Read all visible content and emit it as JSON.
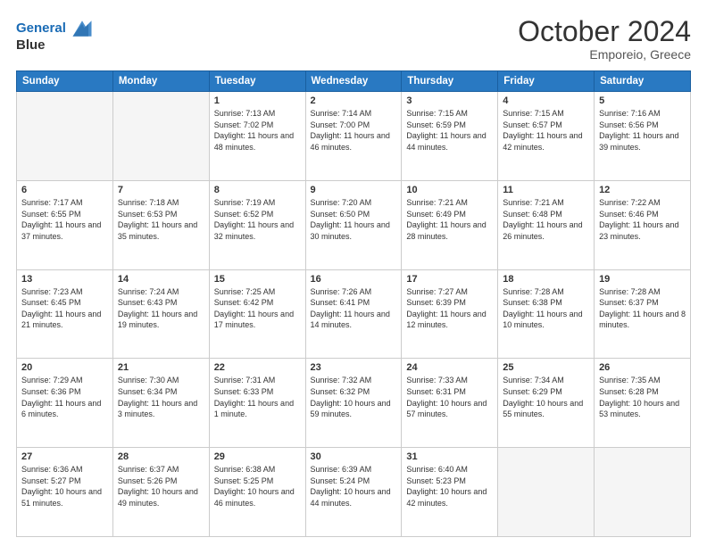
{
  "header": {
    "logo_line1": "General",
    "logo_line2": "Blue",
    "month": "October 2024",
    "location": "Emporeio, Greece"
  },
  "weekdays": [
    "Sunday",
    "Monday",
    "Tuesday",
    "Wednesday",
    "Thursday",
    "Friday",
    "Saturday"
  ],
  "weeks": [
    [
      {
        "day": "",
        "sunrise": "",
        "sunset": "",
        "daylight": "",
        "empty": true
      },
      {
        "day": "",
        "sunrise": "",
        "sunset": "",
        "daylight": "",
        "empty": true
      },
      {
        "day": "1",
        "sunrise": "Sunrise: 7:13 AM",
        "sunset": "Sunset: 7:02 PM",
        "daylight": "Daylight: 11 hours and 48 minutes."
      },
      {
        "day": "2",
        "sunrise": "Sunrise: 7:14 AM",
        "sunset": "Sunset: 7:00 PM",
        "daylight": "Daylight: 11 hours and 46 minutes."
      },
      {
        "day": "3",
        "sunrise": "Sunrise: 7:15 AM",
        "sunset": "Sunset: 6:59 PM",
        "daylight": "Daylight: 11 hours and 44 minutes."
      },
      {
        "day": "4",
        "sunrise": "Sunrise: 7:15 AM",
        "sunset": "Sunset: 6:57 PM",
        "daylight": "Daylight: 11 hours and 42 minutes."
      },
      {
        "day": "5",
        "sunrise": "Sunrise: 7:16 AM",
        "sunset": "Sunset: 6:56 PM",
        "daylight": "Daylight: 11 hours and 39 minutes."
      }
    ],
    [
      {
        "day": "6",
        "sunrise": "Sunrise: 7:17 AM",
        "sunset": "Sunset: 6:55 PM",
        "daylight": "Daylight: 11 hours and 37 minutes."
      },
      {
        "day": "7",
        "sunrise": "Sunrise: 7:18 AM",
        "sunset": "Sunset: 6:53 PM",
        "daylight": "Daylight: 11 hours and 35 minutes."
      },
      {
        "day": "8",
        "sunrise": "Sunrise: 7:19 AM",
        "sunset": "Sunset: 6:52 PM",
        "daylight": "Daylight: 11 hours and 32 minutes."
      },
      {
        "day": "9",
        "sunrise": "Sunrise: 7:20 AM",
        "sunset": "Sunset: 6:50 PM",
        "daylight": "Daylight: 11 hours and 30 minutes."
      },
      {
        "day": "10",
        "sunrise": "Sunrise: 7:21 AM",
        "sunset": "Sunset: 6:49 PM",
        "daylight": "Daylight: 11 hours and 28 minutes."
      },
      {
        "day": "11",
        "sunrise": "Sunrise: 7:21 AM",
        "sunset": "Sunset: 6:48 PM",
        "daylight": "Daylight: 11 hours and 26 minutes."
      },
      {
        "day": "12",
        "sunrise": "Sunrise: 7:22 AM",
        "sunset": "Sunset: 6:46 PM",
        "daylight": "Daylight: 11 hours and 23 minutes."
      }
    ],
    [
      {
        "day": "13",
        "sunrise": "Sunrise: 7:23 AM",
        "sunset": "Sunset: 6:45 PM",
        "daylight": "Daylight: 11 hours and 21 minutes."
      },
      {
        "day": "14",
        "sunrise": "Sunrise: 7:24 AM",
        "sunset": "Sunset: 6:43 PM",
        "daylight": "Daylight: 11 hours and 19 minutes."
      },
      {
        "day": "15",
        "sunrise": "Sunrise: 7:25 AM",
        "sunset": "Sunset: 6:42 PM",
        "daylight": "Daylight: 11 hours and 17 minutes."
      },
      {
        "day": "16",
        "sunrise": "Sunrise: 7:26 AM",
        "sunset": "Sunset: 6:41 PM",
        "daylight": "Daylight: 11 hours and 14 minutes."
      },
      {
        "day": "17",
        "sunrise": "Sunrise: 7:27 AM",
        "sunset": "Sunset: 6:39 PM",
        "daylight": "Daylight: 11 hours and 12 minutes."
      },
      {
        "day": "18",
        "sunrise": "Sunrise: 7:28 AM",
        "sunset": "Sunset: 6:38 PM",
        "daylight": "Daylight: 11 hours and 10 minutes."
      },
      {
        "day": "19",
        "sunrise": "Sunrise: 7:28 AM",
        "sunset": "Sunset: 6:37 PM",
        "daylight": "Daylight: 11 hours and 8 minutes."
      }
    ],
    [
      {
        "day": "20",
        "sunrise": "Sunrise: 7:29 AM",
        "sunset": "Sunset: 6:36 PM",
        "daylight": "Daylight: 11 hours and 6 minutes."
      },
      {
        "day": "21",
        "sunrise": "Sunrise: 7:30 AM",
        "sunset": "Sunset: 6:34 PM",
        "daylight": "Daylight: 11 hours and 3 minutes."
      },
      {
        "day": "22",
        "sunrise": "Sunrise: 7:31 AM",
        "sunset": "Sunset: 6:33 PM",
        "daylight": "Daylight: 11 hours and 1 minute."
      },
      {
        "day": "23",
        "sunrise": "Sunrise: 7:32 AM",
        "sunset": "Sunset: 6:32 PM",
        "daylight": "Daylight: 10 hours and 59 minutes."
      },
      {
        "day": "24",
        "sunrise": "Sunrise: 7:33 AM",
        "sunset": "Sunset: 6:31 PM",
        "daylight": "Daylight: 10 hours and 57 minutes."
      },
      {
        "day": "25",
        "sunrise": "Sunrise: 7:34 AM",
        "sunset": "Sunset: 6:29 PM",
        "daylight": "Daylight: 10 hours and 55 minutes."
      },
      {
        "day": "26",
        "sunrise": "Sunrise: 7:35 AM",
        "sunset": "Sunset: 6:28 PM",
        "daylight": "Daylight: 10 hours and 53 minutes."
      }
    ],
    [
      {
        "day": "27",
        "sunrise": "Sunrise: 6:36 AM",
        "sunset": "Sunset: 5:27 PM",
        "daylight": "Daylight: 10 hours and 51 minutes."
      },
      {
        "day": "28",
        "sunrise": "Sunrise: 6:37 AM",
        "sunset": "Sunset: 5:26 PM",
        "daylight": "Daylight: 10 hours and 49 minutes."
      },
      {
        "day": "29",
        "sunrise": "Sunrise: 6:38 AM",
        "sunset": "Sunset: 5:25 PM",
        "daylight": "Daylight: 10 hours and 46 minutes."
      },
      {
        "day": "30",
        "sunrise": "Sunrise: 6:39 AM",
        "sunset": "Sunset: 5:24 PM",
        "daylight": "Daylight: 10 hours and 44 minutes."
      },
      {
        "day": "31",
        "sunrise": "Sunrise: 6:40 AM",
        "sunset": "Sunset: 5:23 PM",
        "daylight": "Daylight: 10 hours and 42 minutes."
      },
      {
        "day": "",
        "sunrise": "",
        "sunset": "",
        "daylight": "",
        "empty": true
      },
      {
        "day": "",
        "sunrise": "",
        "sunset": "",
        "daylight": "",
        "empty": true
      }
    ]
  ]
}
